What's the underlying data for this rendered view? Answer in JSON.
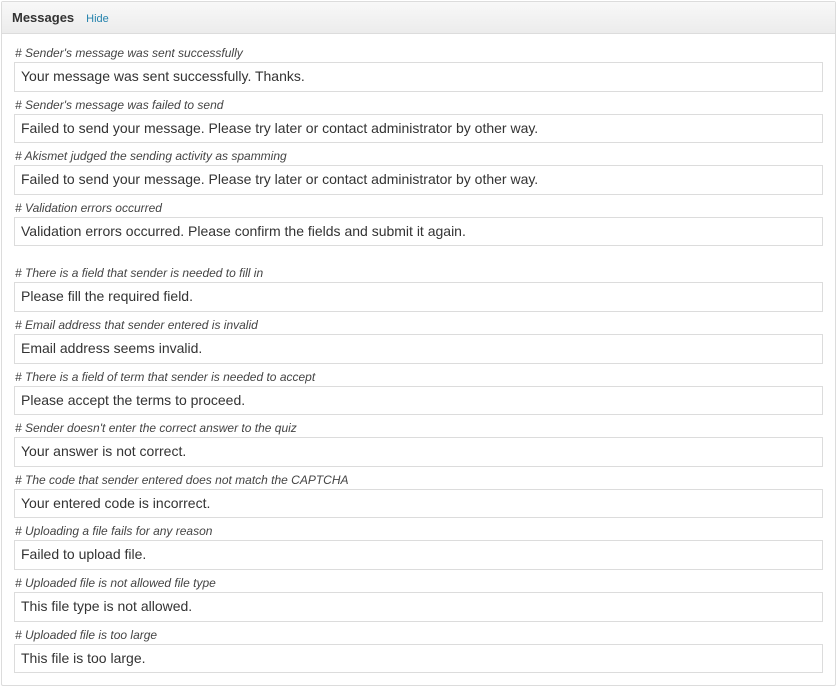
{
  "panel": {
    "title": "Messages",
    "hide": "Hide"
  },
  "group1": [
    {
      "label": "# Sender's message was sent successfully",
      "value": "Your message was sent successfully. Thanks."
    },
    {
      "label": "# Sender's message was failed to send",
      "value": "Failed to send your message. Please try later or contact administrator by other way."
    },
    {
      "label": "# Akismet judged the sending activity as spamming",
      "value": "Failed to send your message. Please try later or contact administrator by other way."
    },
    {
      "label": "# Validation errors occurred",
      "value": "Validation errors occurred. Please confirm the fields and submit it again."
    }
  ],
  "group2": [
    {
      "label": "# There is a field that sender is needed to fill in",
      "value": "Please fill the required field."
    },
    {
      "label": "# Email address that sender entered is invalid",
      "value": "Email address seems invalid."
    },
    {
      "label": "# There is a field of term that sender is needed to accept",
      "value": "Please accept the terms to proceed."
    },
    {
      "label": "# Sender doesn't enter the correct answer to the quiz",
      "value": "Your answer is not correct."
    },
    {
      "label": "# The code that sender entered does not match the CAPTCHA",
      "value": "Your entered code is incorrect."
    },
    {
      "label": "# Uploading a file fails for any reason",
      "value": "Failed to upload file."
    },
    {
      "label": "# Uploaded file is not allowed file type",
      "value": "This file type is not allowed."
    },
    {
      "label": "# Uploaded file is too large",
      "value": "This file is too large."
    }
  ]
}
